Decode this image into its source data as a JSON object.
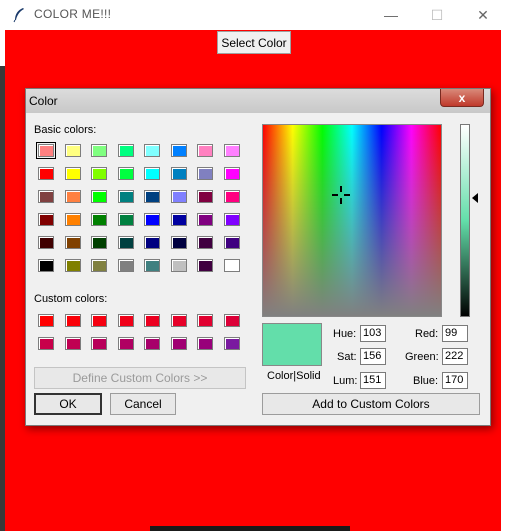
{
  "window": {
    "title": "COLOR ME!!!",
    "background": "#ff0000",
    "min_glyph": "—",
    "max_glyph": "☐",
    "close_glyph": "✕"
  },
  "main": {
    "select_button_label": "Select Color"
  },
  "dialog": {
    "title": "Color",
    "close_glyph": "x",
    "basic_colors_label": "Basic colors:",
    "custom_colors_label": "Custom colors:",
    "define_custom_label": "Define Custom Colors >>",
    "ok_label": "OK",
    "cancel_label": "Cancel",
    "add_custom_label": "Add to Custom Colors",
    "color_solid_label": "Color|Solid",
    "current_color": "#63deaa",
    "fields": {
      "hue": {
        "label": "Hue:",
        "value": "103"
      },
      "sat": {
        "label": "Sat:",
        "value": "156"
      },
      "lum": {
        "label": "Lum:",
        "value": "151"
      },
      "red": {
        "label": "Red:",
        "value": "99"
      },
      "green": {
        "label": "Green:",
        "value": "222"
      },
      "blue": {
        "label": "Blue:",
        "value": "170"
      }
    },
    "basic_colors": [
      [
        "#ff8080",
        "#ffff80",
        "#80ff80",
        "#00ff80",
        "#80ffff",
        "#0080ff",
        "#ff80c0",
        "#ff80ff"
      ],
      [
        "#ff0000",
        "#ffff00",
        "#80ff00",
        "#00ff40",
        "#00ffff",
        "#0080c0",
        "#8080c0",
        "#ff00ff"
      ],
      [
        "#804040",
        "#ff8040",
        "#00ff00",
        "#008080",
        "#004080",
        "#8080ff",
        "#800040",
        "#ff0080"
      ],
      [
        "#800000",
        "#ff8000",
        "#008000",
        "#008040",
        "#0000ff",
        "#0000a0",
        "#800080",
        "#8000ff"
      ],
      [
        "#400000",
        "#804000",
        "#004000",
        "#004040",
        "#000080",
        "#000040",
        "#400040",
        "#400080"
      ],
      [
        "#000000",
        "#808000",
        "#808040",
        "#808080",
        "#408080",
        "#c0c0c0",
        "#400040",
        "#ffffff"
      ]
    ],
    "custom_colors": [
      [
        "#ff0000",
        "#fa0008",
        "#f50010",
        "#f00018",
        "#eb0020",
        "#e60028",
        "#e10030",
        "#dc0038"
      ],
      [
        "#c8004a",
        "#c00052",
        "#b8005a",
        "#b00062",
        "#a8006a",
        "#a00072",
        "#98007a",
        "#7a1aa0"
      ]
    ]
  }
}
